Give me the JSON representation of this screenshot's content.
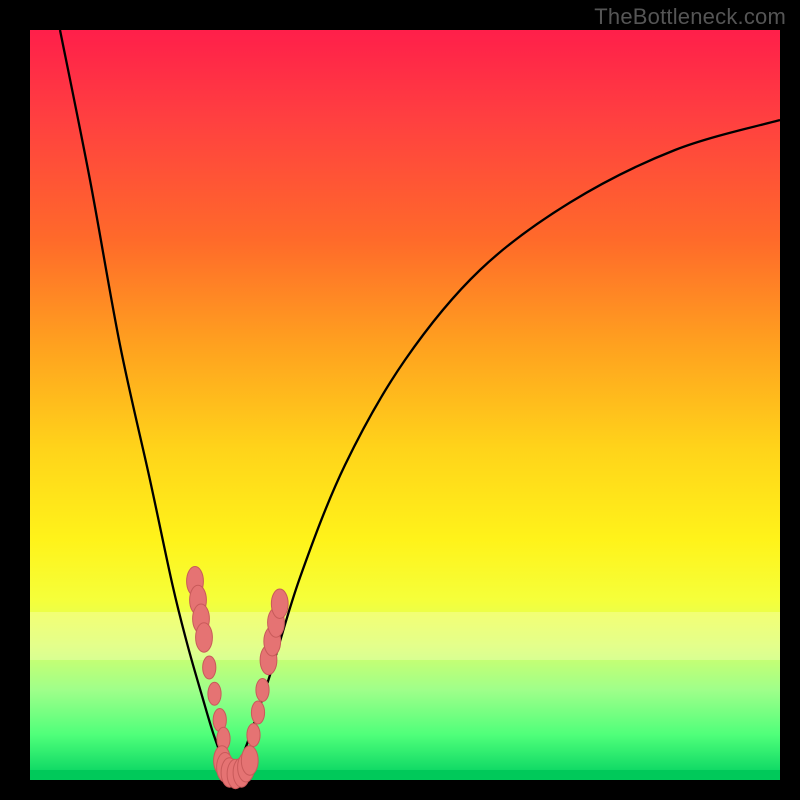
{
  "watermark": "TheBottleneck.com",
  "colors": {
    "dot_fill": "#e57373",
    "dot_stroke": "#c85a5a",
    "curve": "#000000",
    "frame": "#000000"
  },
  "chart_data": {
    "type": "line",
    "title": "",
    "xlabel": "",
    "ylabel": "",
    "xlim": [
      0,
      100
    ],
    "ylim": [
      0,
      100
    ],
    "grid": false,
    "legend": false,
    "series": [
      {
        "name": "left-curve",
        "x": [
          4,
          8,
          12,
          16,
          19,
          21,
          23,
          24.5,
          26,
          27
        ],
        "y": [
          100,
          80,
          58,
          40,
          26,
          18,
          11,
          6,
          2,
          0
        ]
      },
      {
        "name": "right-curve",
        "x": [
          27,
          29,
          32,
          36,
          42,
          50,
          60,
          72,
          86,
          100
        ],
        "y": [
          0,
          5,
          14,
          27,
          42,
          56,
          68,
          77,
          84,
          88
        ]
      }
    ],
    "markers": [
      {
        "x": 22.0,
        "y": 26.5,
        "r": 1.4
      },
      {
        "x": 22.4,
        "y": 24.0,
        "r": 1.4
      },
      {
        "x": 22.8,
        "y": 21.5,
        "r": 1.4
      },
      {
        "x": 23.2,
        "y": 19.0,
        "r": 1.4
      },
      {
        "x": 23.9,
        "y": 15.0,
        "r": 1.1
      },
      {
        "x": 24.6,
        "y": 11.5,
        "r": 1.1
      },
      {
        "x": 25.3,
        "y": 8.0,
        "r": 1.1
      },
      {
        "x": 25.8,
        "y": 5.5,
        "r": 1.1
      },
      {
        "x": 25.6,
        "y": 2.6,
        "r": 1.4
      },
      {
        "x": 26.0,
        "y": 1.7,
        "r": 1.4
      },
      {
        "x": 26.6,
        "y": 1.0,
        "r": 1.4
      },
      {
        "x": 27.4,
        "y": 0.8,
        "r": 1.4
      },
      {
        "x": 28.2,
        "y": 1.0,
        "r": 1.4
      },
      {
        "x": 28.8,
        "y": 1.7,
        "r": 1.4
      },
      {
        "x": 29.3,
        "y": 2.6,
        "r": 1.4
      },
      {
        "x": 29.8,
        "y": 6.0,
        "r": 1.1
      },
      {
        "x": 30.4,
        "y": 9.0,
        "r": 1.1
      },
      {
        "x": 31.0,
        "y": 12.0,
        "r": 1.1
      },
      {
        "x": 31.8,
        "y": 16.0,
        "r": 1.4
      },
      {
        "x": 32.3,
        "y": 18.5,
        "r": 1.4
      },
      {
        "x": 32.8,
        "y": 21.0,
        "r": 1.4
      },
      {
        "x": 33.3,
        "y": 23.5,
        "r": 1.4
      }
    ]
  }
}
